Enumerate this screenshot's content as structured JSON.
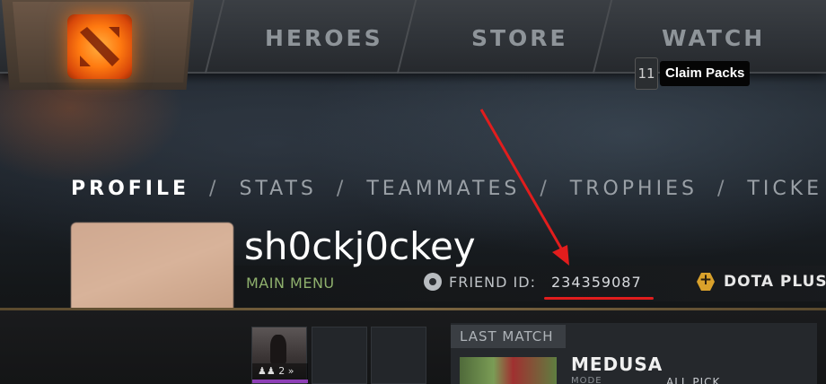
{
  "top_nav": {
    "items": [
      "HEROES",
      "STORE",
      "WATCH"
    ]
  },
  "claim_tooltip": {
    "count": "11",
    "label": "Claim Packs"
  },
  "profile_nav": {
    "tabs": [
      "PROFILE",
      "STATS",
      "TEAMMATES",
      "TROPHIES",
      "TICKE"
    ],
    "separator": "/",
    "active_index": 0
  },
  "profile": {
    "username": "sh0ckj0ckey",
    "main_menu": "MAIN MENU",
    "friend_id_label": "FRIEND ID:",
    "friend_id": "234359087",
    "dota_plus": "DOTA PLUS"
  },
  "hero_slot": {
    "badge": "2"
  },
  "last_match": {
    "label": "LAST MATCH",
    "hero": "MEDUSA",
    "mode_label": "MODE",
    "mode_value": "ALL PICK"
  },
  "colors": {
    "accent_green": "#8fb16d",
    "annotation_red": "#e11d1d",
    "dota_plus_gold": "#d9a12b",
    "hero_bar_purple": "#8d3fb6"
  },
  "icons": [
    "dota-logo-icon",
    "steam-icon",
    "dota-plus-icon",
    "hero-portrait"
  ]
}
